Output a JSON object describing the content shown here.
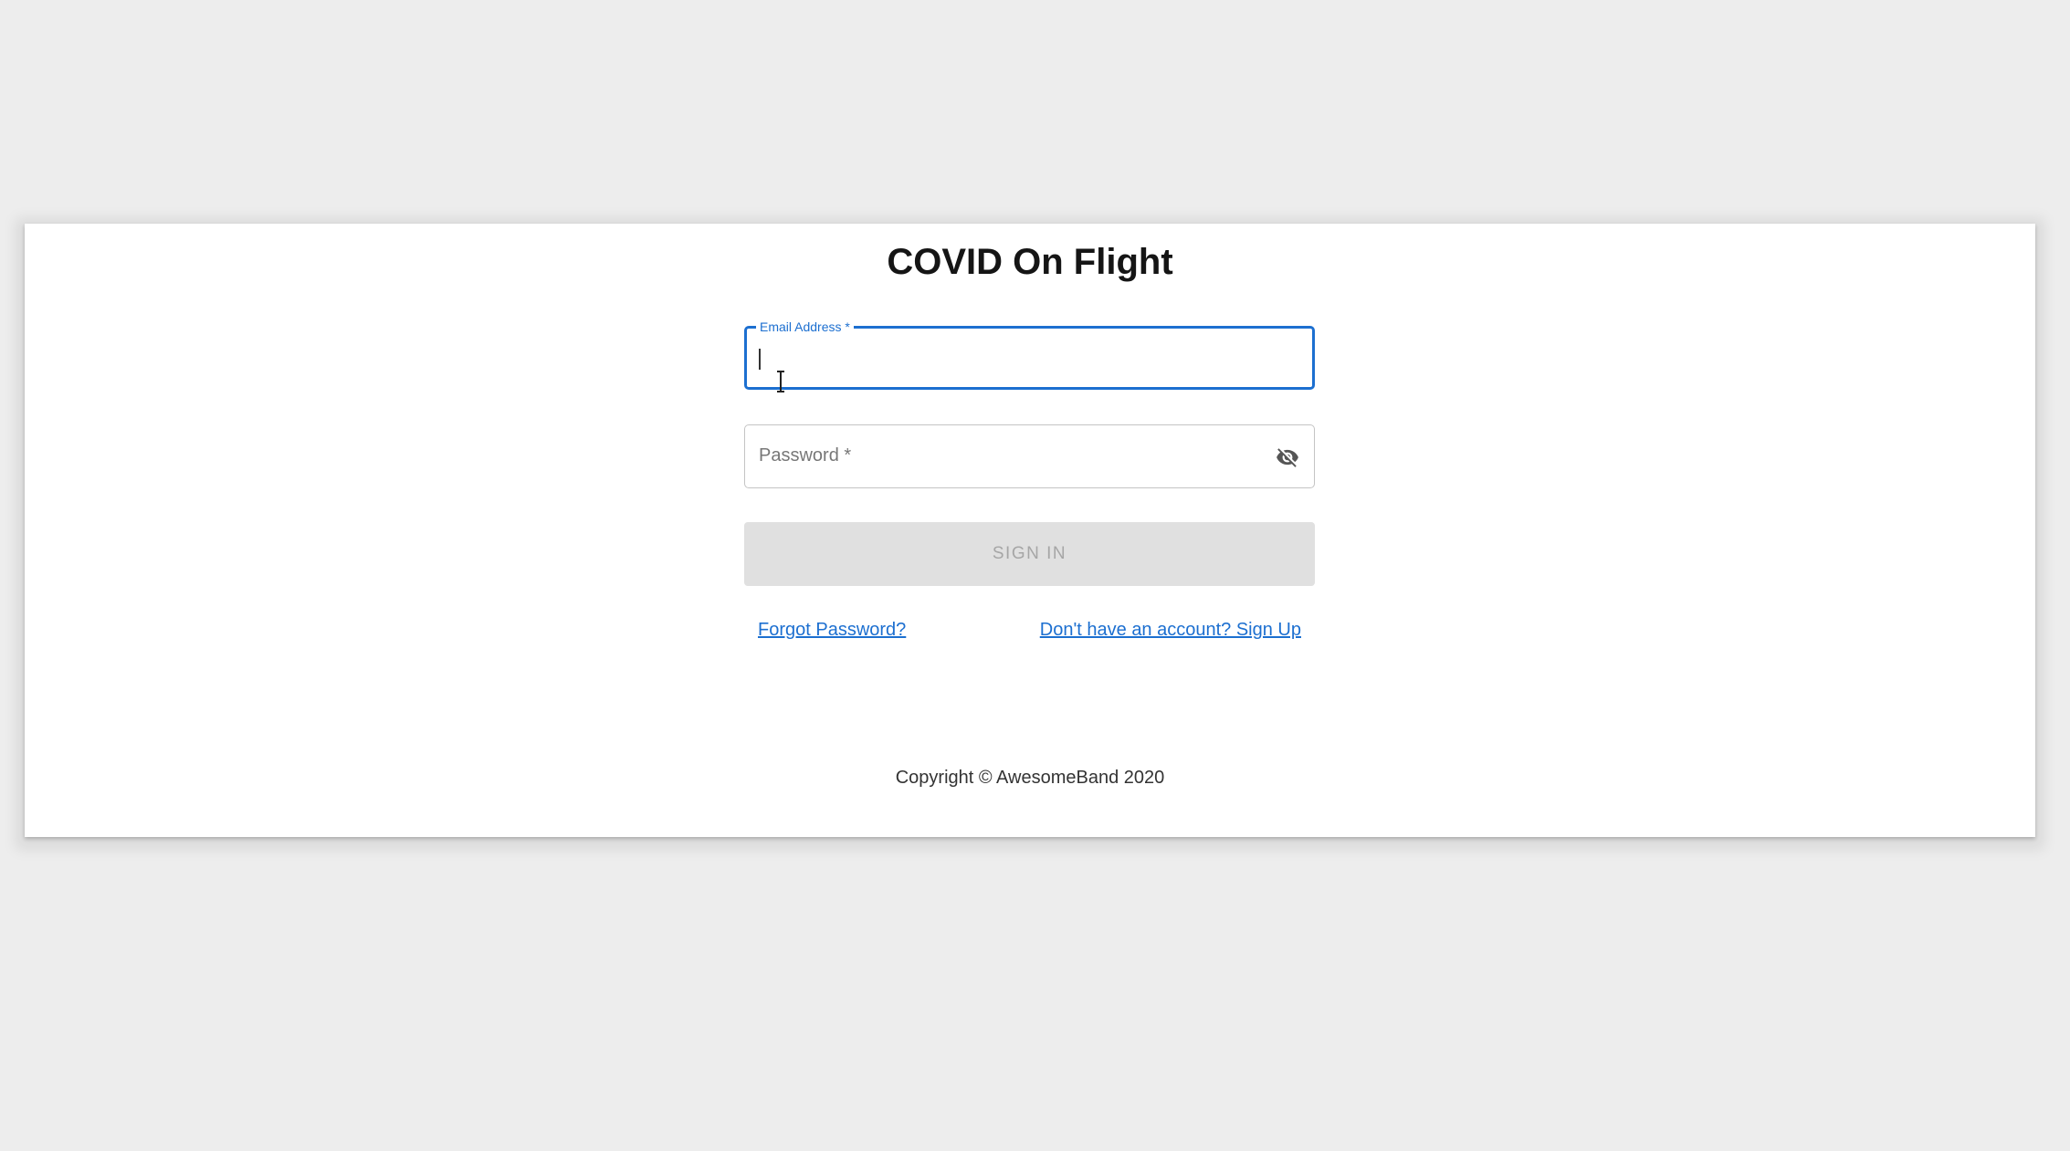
{
  "app": {
    "title": "COVID On Flight"
  },
  "form": {
    "email": {
      "label": "Email Address *",
      "value": ""
    },
    "password": {
      "label": "Password *",
      "value": "",
      "visibility_icon": "visibility-off-icon"
    },
    "submit_label": "SIGN IN"
  },
  "links": {
    "forgot_password": "Forgot Password?",
    "sign_up": "Don't have an account? Sign Up"
  },
  "footer": {
    "copyright": "Copyright © AwesomeBand 2020"
  },
  "colors": {
    "accent": "#1c6fd0",
    "background": "#ededed",
    "card": "#ffffff",
    "disabled_button": "#e0e0e0"
  }
}
